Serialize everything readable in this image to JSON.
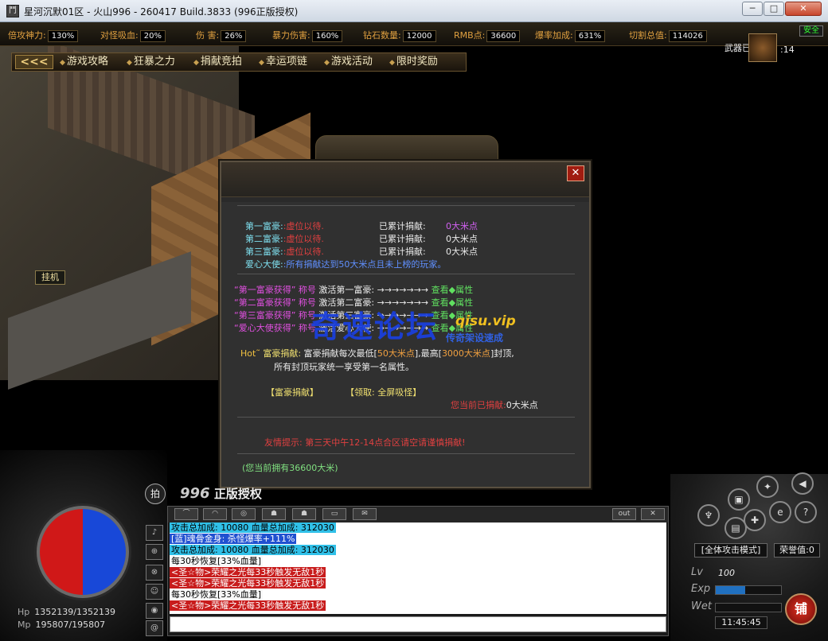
{
  "window": {
    "title": "星河沉默01区 - 火山996 - 260417 Build.3833 (996正版授权)",
    "min_label": "─",
    "max_label": "□",
    "close_label": "✕"
  },
  "stats": [
    {
      "label": "倍攻神力:",
      "value": "130%"
    },
    {
      "label": "对怪吸血:",
      "value": "20%"
    },
    {
      "label": "伤  害:",
      "value": "26%"
    },
    {
      "label": "暴力伤害:",
      "value": "160%"
    },
    {
      "label": "钻石数量:",
      "value": "12000"
    },
    {
      "label": "RMB点:",
      "value": "36600"
    },
    {
      "label": "爆率加成:",
      "value": "631%"
    },
    {
      "label": "切割总值:",
      "value": "114026"
    }
  ],
  "safe_label": "安全",
  "menu": {
    "back_label": "<<<",
    "items": [
      "游戏攻略",
      "狂暴之力",
      "捐献竞拍",
      "幸运项链",
      "游戏活动",
      "限时奖励"
    ]
  },
  "weapon": {
    "label": "武器已激活",
    "value": ":14"
  },
  "hangup_label": "挂机",
  "dialog": {
    "close_label": "✕",
    "ranks": [
      {
        "name": "第一富豪:",
        "holder": ":虚位以待.",
        "sum_label": "已累计捐献:",
        "sum": "0大米点"
      },
      {
        "name": "第二富豪:",
        "holder": ":虚位以待.",
        "sum_label": "已累计捐献:",
        "sum": "0大米点"
      },
      {
        "name": "第三富豪:",
        "holder": ":虚位以待.",
        "sum_label": "已累计捐献:",
        "sum": "0大米点"
      }
    ],
    "ambassador_name": "爱心大使:",
    "ambassador_text": ":所有捐献达到50大米点且未上榜的玩家。",
    "titles": [
      {
        "title": "“第一富豪获得” 称号",
        "act": "激活第一富豪:",
        "arrow": "→→→→→→→",
        "view": "查看◆属性"
      },
      {
        "title": "“第二富豪获得” 称号",
        "act": "激活第二富豪:",
        "arrow": "→→→→→→→",
        "view": "查看◆属性"
      },
      {
        "title": "“第三富豪获得” 称号",
        "act": "激活第三富豪:",
        "arrow": "→→→→→→→",
        "view": "查看◆属性"
      },
      {
        "title": "“爱心大使获得” 称号",
        "act": "激活爱心大使:",
        "arrow": "→→→→→→→",
        "view": "查看◆属性"
      }
    ],
    "hot_label": "Hot˜",
    "donate_line_label": "富豪捐献:",
    "donate_line_text1": "富豪捐献每次最低[",
    "donate_min": "50大米点",
    "donate_line_text2": "],最高[",
    "donate_max": "3000大米点",
    "donate_line_text3": "]封顶,",
    "donate_line2": "所有封顶玩家统一享受第一名属性。",
    "donate_btn": "【富豪捐献】",
    "claim_btn": "【领取: 全屏吸怪】",
    "current_label": "您当前已捐献:",
    "current_value": "0大米点",
    "tip": "友情提示: 第三天中午12-14点合区请空请谨慎捐献!",
    "own": "(您当前拥有36600大米)"
  },
  "watermark": {
    "main": "奇速论坛",
    "sub": "qisu.vip",
    "sub2": "传奇架设速成"
  },
  "hud": {
    "hp_label": "Hp",
    "hp": "1352139/1352139",
    "mp_label": "Mp",
    "mp": "195807/195807",
    "auction_label": "拍",
    "brand_prefix": "996",
    "brand_text": "正版授权",
    "chat_out": "out",
    "chat_close": "✕",
    "mode": "[全体攻击模式]",
    "honor": "荣誉值:0",
    "lv_label": "Lv",
    "lv_value": "100",
    "exp_label": "Exp",
    "exp_fill": 0.45,
    "wet_label": "Wet",
    "wet_fill": 0,
    "time": "11:45:45",
    "shop_label": "铺"
  },
  "chat": [
    {
      "style": "m-cyan",
      "text": "攻击总加成: 10080      血量总加成: 312030"
    },
    {
      "style": "m-blue",
      "text": "[蓝]魂骨金身: 杀怪爆率+111%"
    },
    {
      "style": "m-cyan",
      "text": "攻击总加成: 10080      血量总加成: 312030"
    },
    {
      "style": "m-white",
      "text": "每30秒恢复[33%血量]"
    },
    {
      "style": "m-red",
      "text": "<圣☆物>荣耀之光每33秒触发无敌1秒"
    },
    {
      "style": "m-red",
      "text": "<圣☆物>荣耀之光每33秒触发无敌1秒"
    },
    {
      "style": "m-white",
      "text": "每30秒恢复[33%血量]"
    },
    {
      "style": "m-red",
      "text": "<圣☆物>荣耀之光每33秒触发无敌1秒"
    }
  ]
}
